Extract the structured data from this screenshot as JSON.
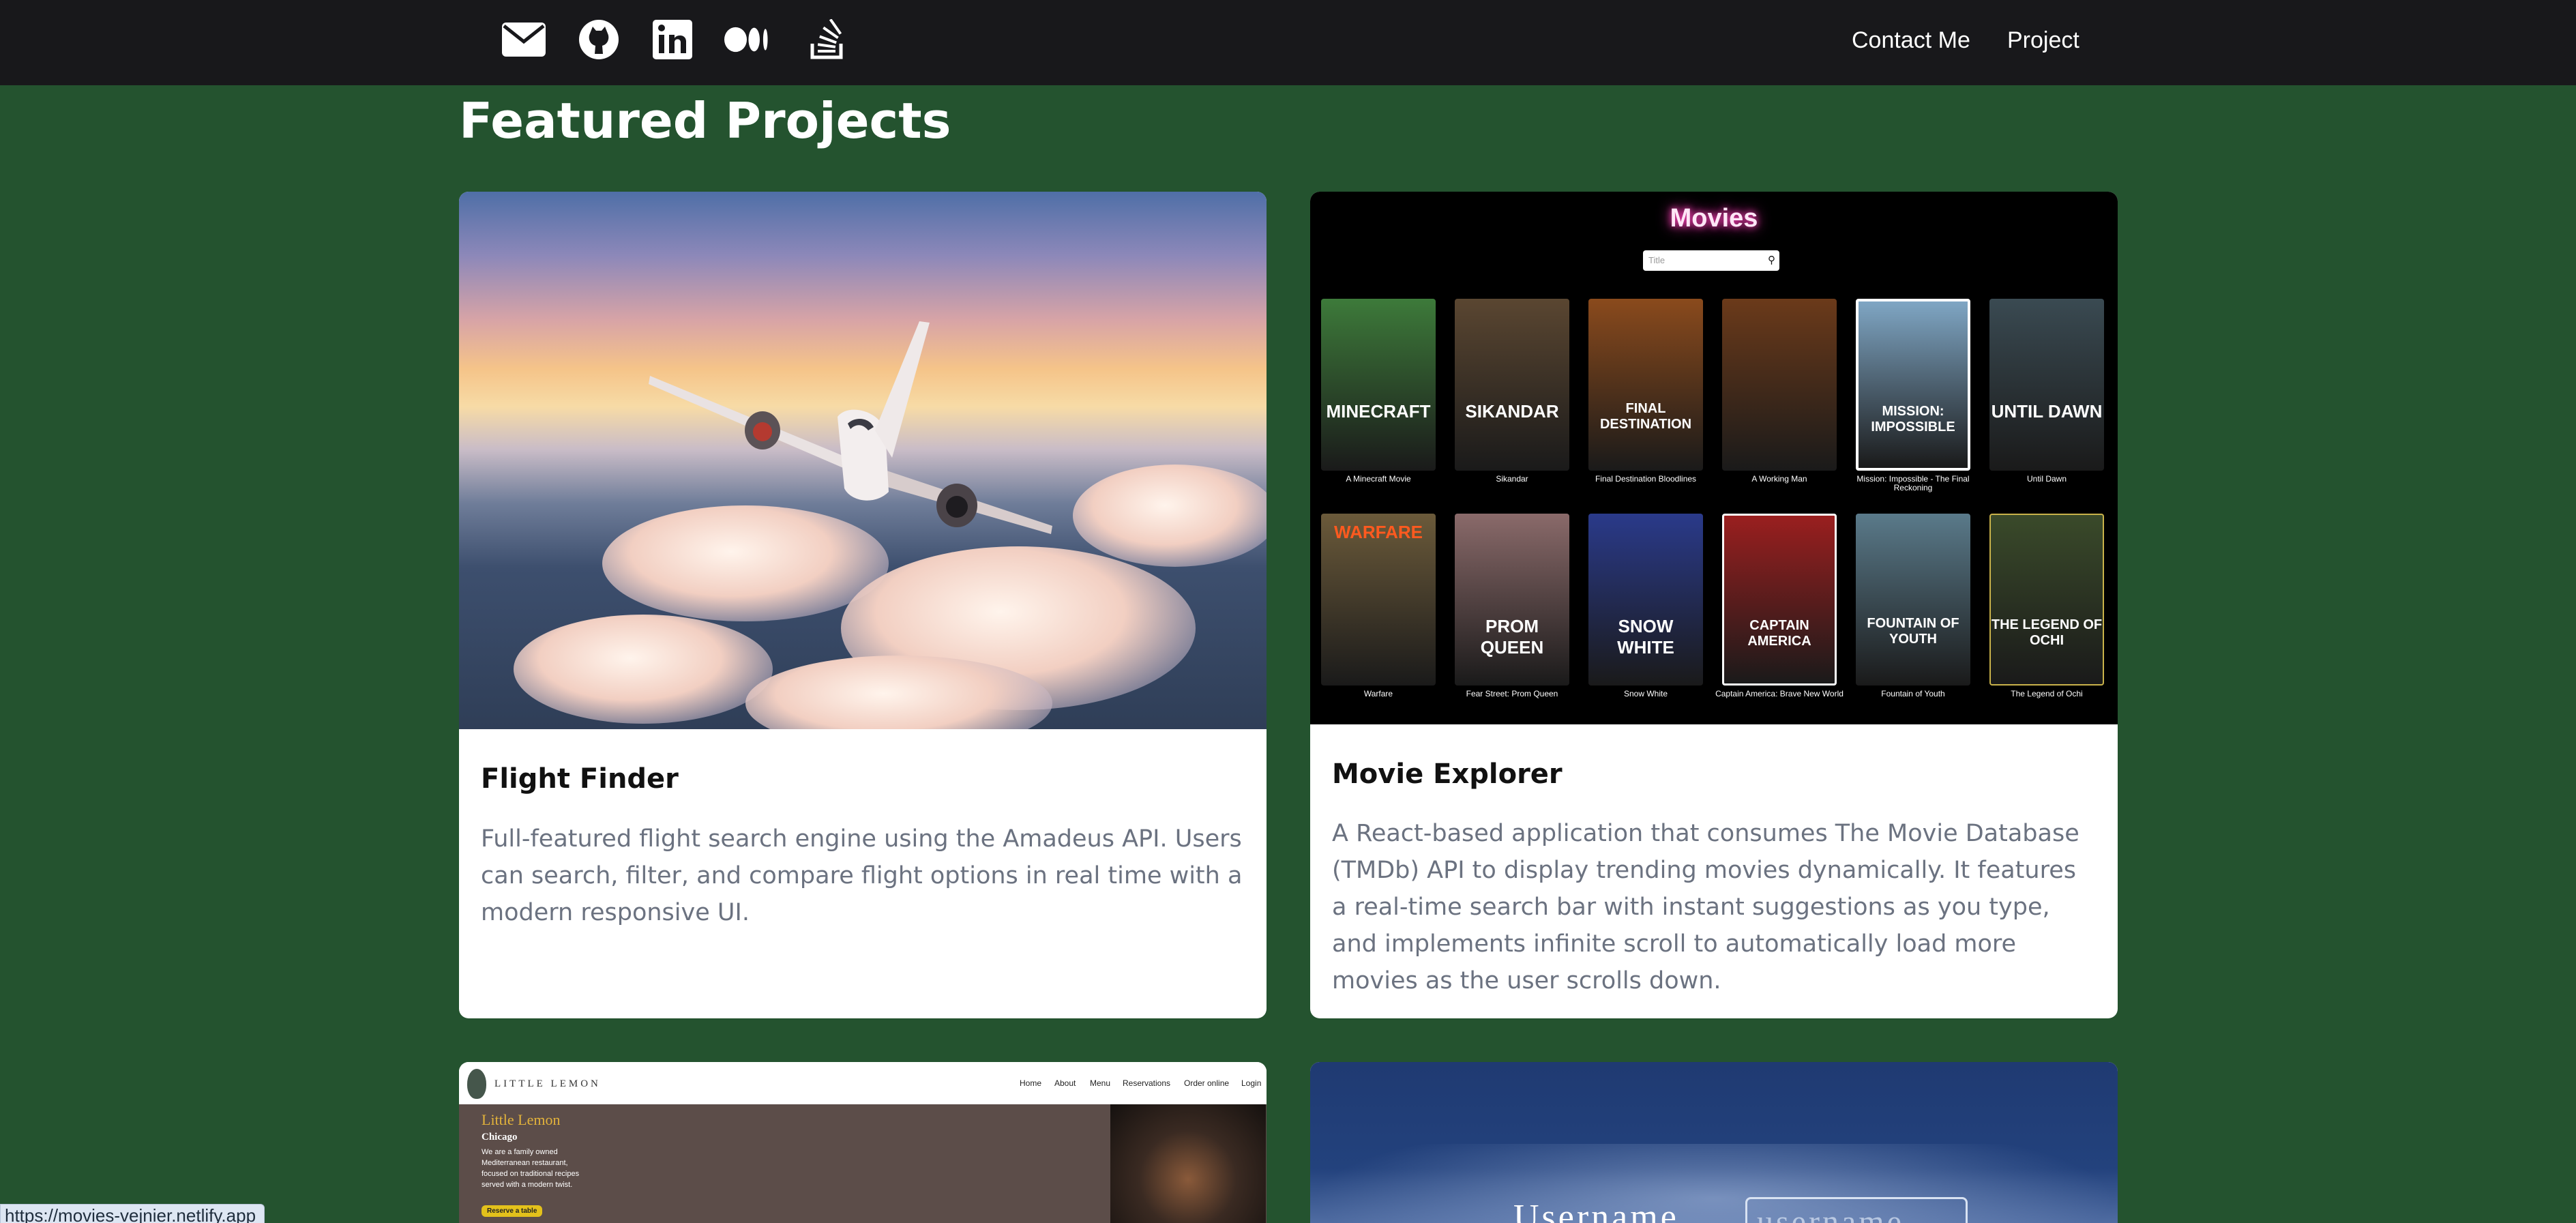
{
  "nav": {
    "icons": [
      "mail-icon",
      "github-icon",
      "linkedin-icon",
      "medium-icon",
      "stackoverflow-icon"
    ],
    "links": [
      "Contact Me",
      "Project"
    ]
  },
  "section": {
    "title": "Featured Projects"
  },
  "projects": [
    {
      "title": "Flight Finder",
      "description": "Full-featured flight search engine using the Amadeus API. Users can search, filter, and compare flight options in real time with a modern responsive UI."
    },
    {
      "title": "Movie Explorer",
      "description": "A React-based application that consumes The Movie Database (TMDb) API to display trending movies dynamically. It features a real-time search bar with instant suggestions as you type, and implements infinite scroll to automatically load more movies as the user scrolls down."
    }
  ],
  "movie_screenshot": {
    "heading": "Movies",
    "search_placeholder": "Title",
    "posters": [
      {
        "caption": "A Minecraft Movie",
        "art": "MINECRAFT",
        "color": "#3d7a3a"
      },
      {
        "caption": "Sikandar",
        "art": "SIKANDAR",
        "color": "#5a4631"
      },
      {
        "caption": "Final Destination Bloodlines",
        "art": "FINAL DESTINATION",
        "color": "#8a4a1c"
      },
      {
        "caption": "A Working Man",
        "art": "",
        "color": "#6b3a1a"
      },
      {
        "caption": "Mission: Impossible - The Final Reckoning",
        "art": "MISSION: IMPOSSIBLE",
        "color": "#7fa6c4"
      },
      {
        "caption": "Until Dawn",
        "art": "UNTIL DAWN",
        "color": "#3a4a52"
      },
      {
        "caption": "Warfare",
        "art": "WARFARE",
        "color": "#6b5a3a"
      },
      {
        "caption": "Fear Street: Prom Queen",
        "art": "PROM QUEEN",
        "color": "#8a6a6a"
      },
      {
        "caption": "Snow White",
        "art": "SNOW WHITE",
        "color": "#2a3a8a"
      },
      {
        "caption": "Captain America: Brave New World",
        "art": "CAPTAIN AMERICA",
        "color": "#9a1f1f"
      },
      {
        "caption": "Fountain of Youth",
        "art": "FOUNTAIN OF YOUTH",
        "color": "#5a7a8a"
      },
      {
        "caption": "The Legend of Ochi",
        "art": "THE LEGEND OF OCHI",
        "color": "#3a4a2a"
      }
    ]
  },
  "little_lemon_screenshot": {
    "brand": "LITTLE LEMON",
    "nav": [
      "Home",
      "About",
      "Menu",
      "Reservations",
      "Order online",
      "Login"
    ],
    "title": "Little Lemon",
    "city": "Chicago",
    "text": "We are a family owned Mediterranean restaurant, focused on traditional recipes served with a modern twist.",
    "button": "Reserve a table"
  },
  "login_screenshot": {
    "label": "Username",
    "placeholder": "username"
  },
  "status_bar": {
    "url": "https://movies-vejnier.netlify.app"
  },
  "colors": {
    "page_bg": "#24532f",
    "nav_bg": "#18181b",
    "card_bg": "#ffffff",
    "desc_text": "#6b7280"
  }
}
